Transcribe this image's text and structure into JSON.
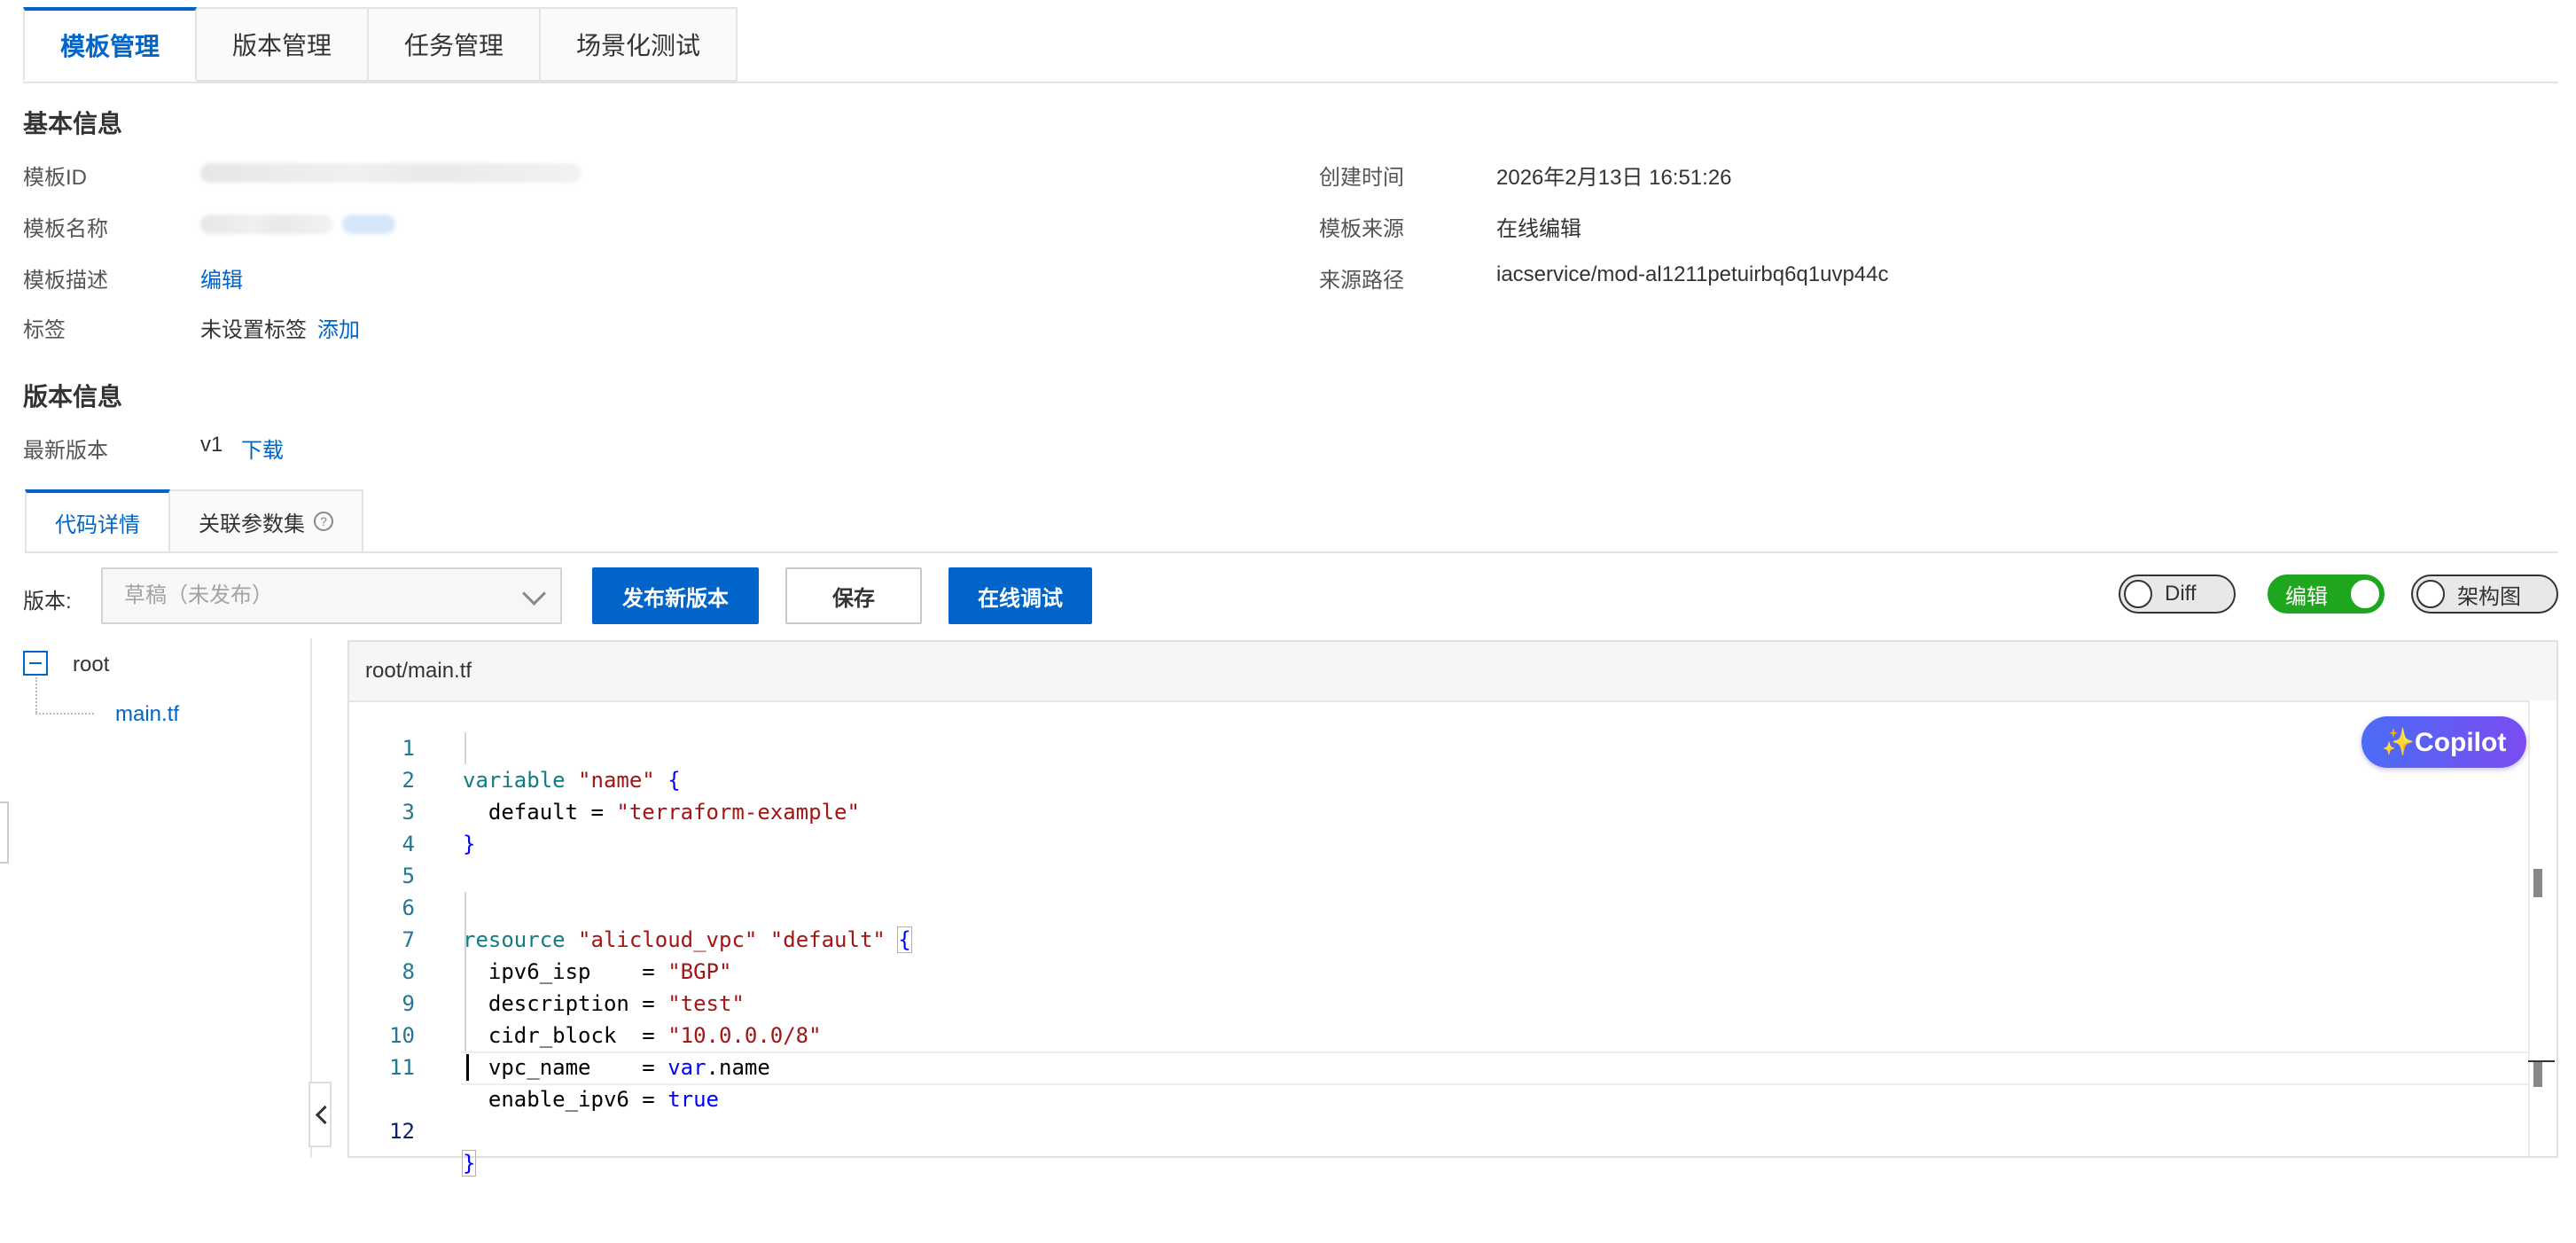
{
  "tabs": [
    {
      "label": "模板管理",
      "active": true
    },
    {
      "label": "版本管理",
      "active": false
    },
    {
      "label": "任务管理",
      "active": false
    },
    {
      "label": "场景化测试",
      "active": false
    }
  ],
  "basic_info": {
    "title": "基本信息",
    "template_id_label": "模板ID",
    "template_name_label": "模板名称",
    "description_label": "模板描述",
    "description_link": "编辑",
    "tags_label": "标签",
    "tags_value": "未设置标签",
    "tags_link": "添加",
    "created_label": "创建时间",
    "created_value": "2026年2月13日 16:51:26",
    "source_label": "模板来源",
    "source_value": "在线编辑",
    "path_label": "来源路径",
    "path_value": "iacservice/mod-al1211petuirbq6q1uvp44c"
  },
  "version_info": {
    "title": "版本信息",
    "latest_label": "最新版本",
    "latest_value": "v1",
    "download_link": "下载"
  },
  "sub_tabs": [
    {
      "label": "代码详情",
      "active": true
    },
    {
      "label": "关联参数集",
      "active": false
    }
  ],
  "toolbar": {
    "version_label": "版本:",
    "version_placeholder": "草稿（未发布）",
    "publish_label": "发布新版本",
    "save_label": "保存",
    "debug_label": "在线调试",
    "diff_label": "Diff",
    "edit_label": "编辑",
    "arch_label": "架构图",
    "diff_on": false,
    "edit_on": true,
    "arch_on": false
  },
  "file_tree": {
    "root": "root",
    "file": "main.tf"
  },
  "editor": {
    "path": "root/main.tf",
    "copilot_label": "✨Copilot",
    "lines": [
      "1",
      "2",
      "3",
      "4",
      "5",
      "6",
      "7",
      "8",
      "9",
      "10",
      "11",
      "12"
    ]
  },
  "colors": {
    "accent": "#0064c8",
    "toggle_on": "#1ea71e",
    "copilot_start": "#4b6cf7",
    "copilot_end": "#7b4cf2"
  }
}
